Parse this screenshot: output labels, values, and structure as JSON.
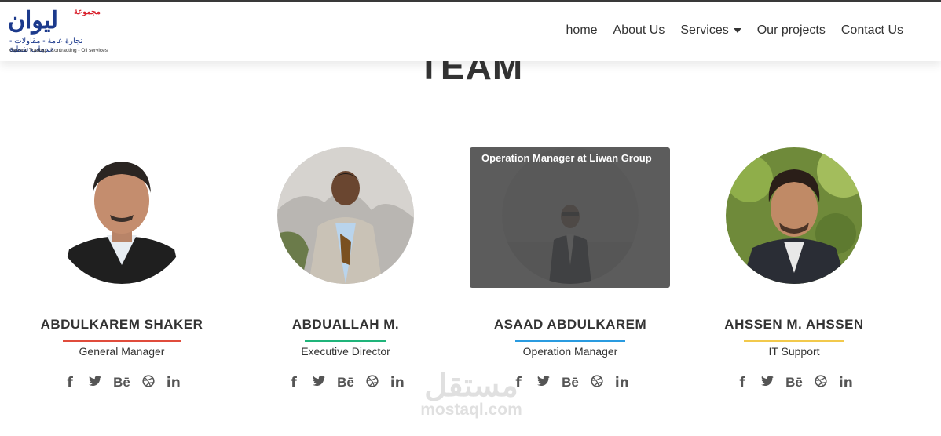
{
  "header": {
    "logo": {
      "brand_small": "مجموعة",
      "brand_big": "ليوان",
      "subtitle_ar": "تجارة عامة - مقاولات - خدمات نفطية",
      "subtitle_en": "General Trading - Contracting - Oil services"
    },
    "nav": [
      {
        "label": "home"
      },
      {
        "label": "About Us"
      },
      {
        "label": "Services"
      },
      {
        "label": "Our projects"
      },
      {
        "label": "Contact Us"
      }
    ]
  },
  "section": {
    "title": "TEAM"
  },
  "members": [
    {
      "name": "ABDULKAREM SHAKER",
      "role": "General Manager",
      "accent": "#e04c3c"
    },
    {
      "name": "ABDUALLAH M.",
      "role": "Executive Director",
      "accent": "#1fb47a"
    },
    {
      "name": "ASAAD ABDULKAREM",
      "role": "Operation Manager",
      "accent": "#2a9be0",
      "overlay_text": "Operation Manager at Liwan Group"
    },
    {
      "name": "AHSSEN M. AHSSEN",
      "role": "IT Support",
      "accent": "#f2c94c"
    }
  ],
  "social_icons": [
    {
      "icon": "facebook-icon",
      "glyph": "f"
    },
    {
      "icon": "twitter-icon",
      "glyph": "🐦"
    },
    {
      "icon": "behance-icon",
      "glyph": "Bē"
    },
    {
      "icon": "dribbble-icon",
      "glyph": "⊕"
    },
    {
      "icon": "linkedin-icon",
      "glyph": "in"
    }
  ],
  "watermark": {
    "arabic": "مستقل",
    "latin": "mostaql.com"
  }
}
